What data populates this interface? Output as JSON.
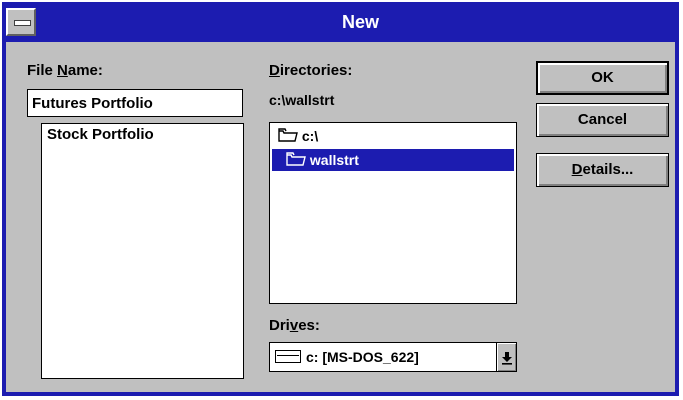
{
  "window": {
    "title": "New",
    "colors": {
      "title_bar": "#1c1cb0",
      "face": "#c0c0c0",
      "selection": "#1c1cb0"
    }
  },
  "file_name": {
    "label_prefix": "File ",
    "label_access": "N",
    "label_suffix": "ame:",
    "value": "Futures Portfolio",
    "files": [
      "Stock Portfolio"
    ]
  },
  "directories": {
    "label_access": "D",
    "label_suffix": "irectories:",
    "current_path": "c:\\wallstrt",
    "items": [
      {
        "name": "c:\\",
        "icon": "folder-open-icon",
        "selected": false
      },
      {
        "name": "wallstrt",
        "icon": "folder-open-icon",
        "selected": true
      }
    ]
  },
  "drives": {
    "label_prefix": "Dri",
    "label_access": "v",
    "label_suffix": "es:",
    "selected": "c: [MS-DOS_622]",
    "icon": "hard-drive-icon",
    "dropdown_icon": "dropdown-arrow-icon"
  },
  "buttons": {
    "ok": "OK",
    "cancel": "Cancel",
    "details_access": "D",
    "details_suffix": "etails..."
  }
}
